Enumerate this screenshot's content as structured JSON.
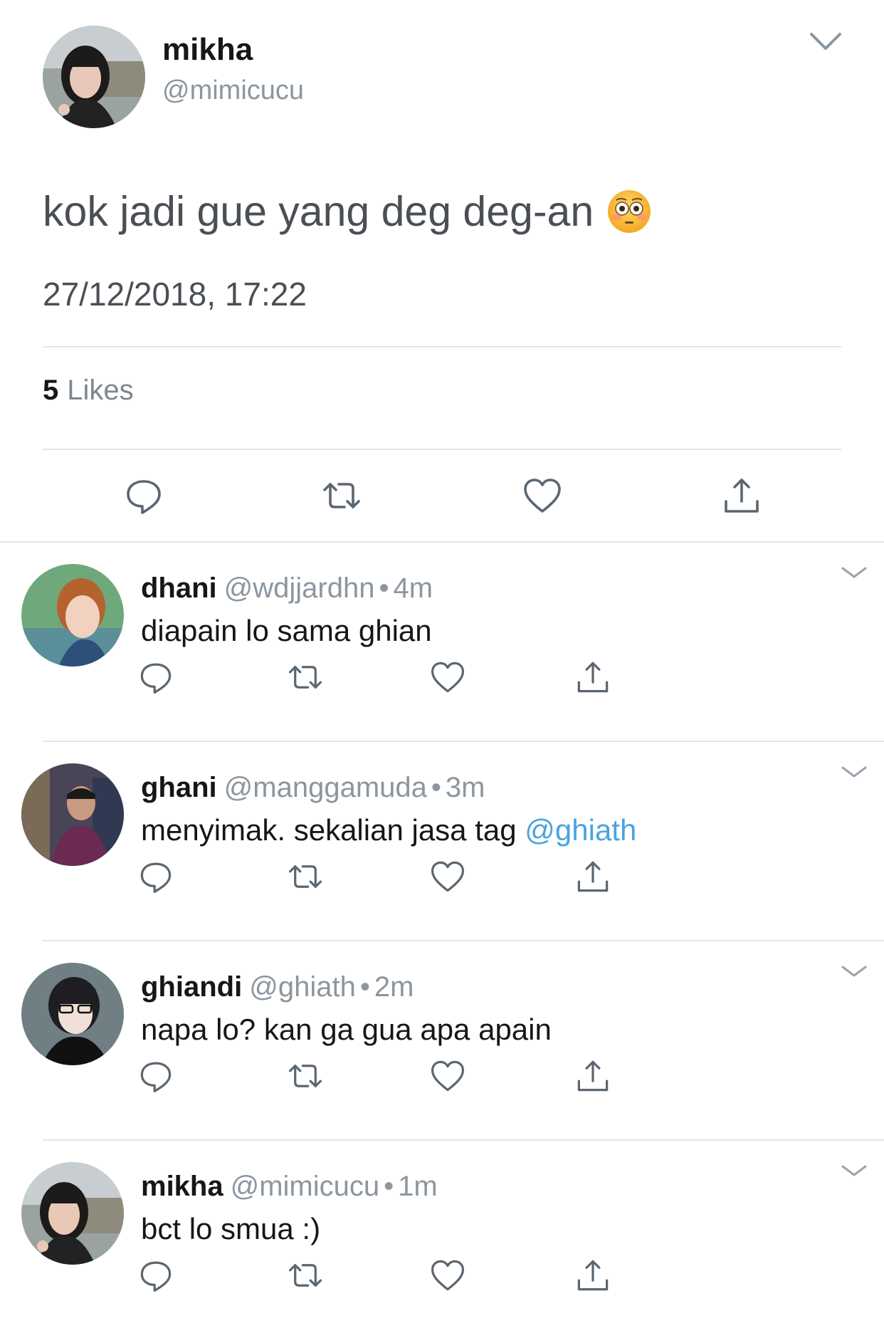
{
  "tweet": {
    "name": "mikha",
    "handle": "@mimicucu",
    "text": "kok jadi gue yang deg deg-an",
    "emoji": "flushed-face",
    "timestamp": "27/12/2018, 17:22",
    "likes_count": "5",
    "likes_label": "Likes"
  },
  "replies": [
    {
      "name": "dhani",
      "handle": "@wdjjardhn",
      "dot": "•",
      "time": "4m",
      "text": "diapain lo sama ghian",
      "mention": ""
    },
    {
      "name": "ghani",
      "handle": "@manggamuda",
      "dot": "•",
      "time": "3m",
      "text": "menyimak. sekalian jasa tag ",
      "mention": "@ghiath"
    },
    {
      "name": "ghiandi",
      "handle": "@ghiath",
      "dot": "•",
      "time": "2m",
      "text": "napa lo? kan ga gua apa apain",
      "mention": ""
    },
    {
      "name": "mikha",
      "handle": "@mimicucu",
      "dot": "•",
      "time": "1m",
      "text": "bct lo smua :)",
      "mention": ""
    }
  ],
  "colors": {
    "text": "#14171a",
    "muted": "#8c969f",
    "mention": "#4aa3df",
    "divider": "#e1e6ea",
    "icon": "#5b6670"
  }
}
